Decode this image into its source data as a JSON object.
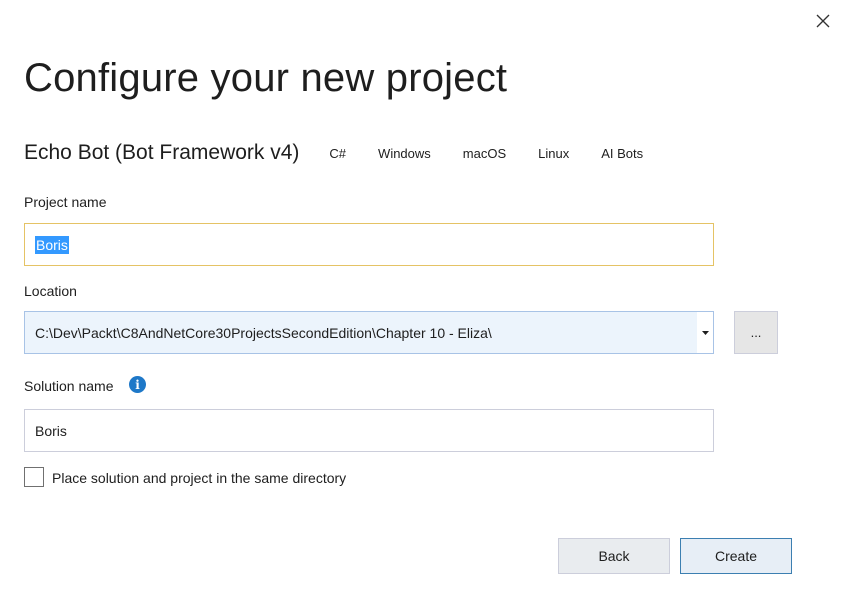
{
  "dialog": {
    "title": "Configure your new project",
    "template": {
      "name": "Echo Bot (Bot Framework v4)",
      "tags": [
        "C#",
        "Windows",
        "macOS",
        "Linux",
        "AI Bots"
      ]
    },
    "project_name": {
      "label": "Project name",
      "value": "Boris"
    },
    "location": {
      "label": "Location",
      "value": "C:\\Dev\\Packt\\C8AndNetCore30ProjectsSecondEdition\\Chapter 10 - Eliza\\",
      "browse_label": "..."
    },
    "solution_name": {
      "label": "Solution name",
      "value": "Boris",
      "info_icon": "info-icon"
    },
    "same_directory": {
      "label": "Place solution and project in the same directory",
      "checked": false
    },
    "buttons": {
      "back": "Back",
      "create": "Create"
    },
    "close_icon": "close-icon"
  },
  "colors": {
    "focus_border": "#e5c365",
    "selection": "#3399ff",
    "accent": "#1e78c8"
  }
}
